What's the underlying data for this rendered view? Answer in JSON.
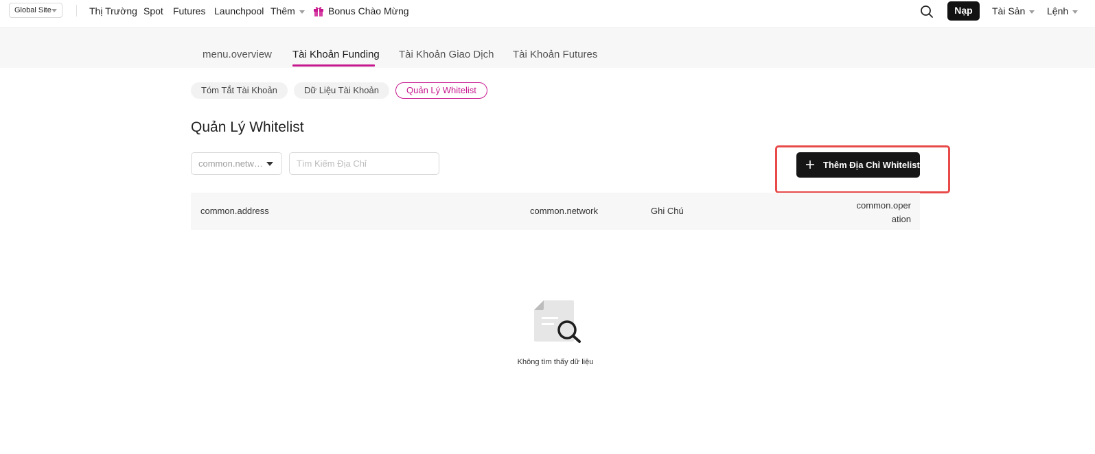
{
  "topnav": {
    "site_selector": "Global Site",
    "items": [
      {
        "label": "Thị Trường"
      },
      {
        "label": "Spot"
      },
      {
        "label": "Futures"
      },
      {
        "label": "Launchpool"
      },
      {
        "label": "Thêm"
      },
      {
        "label": "Bonus Chào Mừng"
      }
    ],
    "deposit_label": "Nạp",
    "assets_label": "Tài Sản",
    "orders_label": "Lệnh",
    "search_icon": "search-icon",
    "gift_icon": "gift-icon"
  },
  "account_tabs": [
    {
      "label": "menu.overview"
    },
    {
      "label": "Tài Khoản Funding"
    },
    {
      "label": "Tài Khoản Giao Dịch"
    },
    {
      "label": "Tài Khoản Futures"
    }
  ],
  "sub_tabs": [
    {
      "label": "Tóm Tắt Tài Khoản"
    },
    {
      "label": "Dữ Liệu Tài Khoản"
    },
    {
      "label": "Quản Lý Whitelist"
    }
  ],
  "page": {
    "title": "Quản Lý Whitelist",
    "network_filter": "common.network",
    "search_placeholder": "Tìm Kiếm Địa Chỉ",
    "add_button": "Thêm Địa Chỉ Whitelist"
  },
  "table": {
    "columns": [
      "common.address",
      "common.network",
      "Ghi Chú",
      "common.operation"
    ]
  },
  "empty": {
    "text": "Không tìm thấy dữ liệu",
    "icon": "document-search-icon"
  },
  "colors": {
    "accent": "#c6178e",
    "highlight": "#e84a4a",
    "primary_button": "#161616"
  }
}
